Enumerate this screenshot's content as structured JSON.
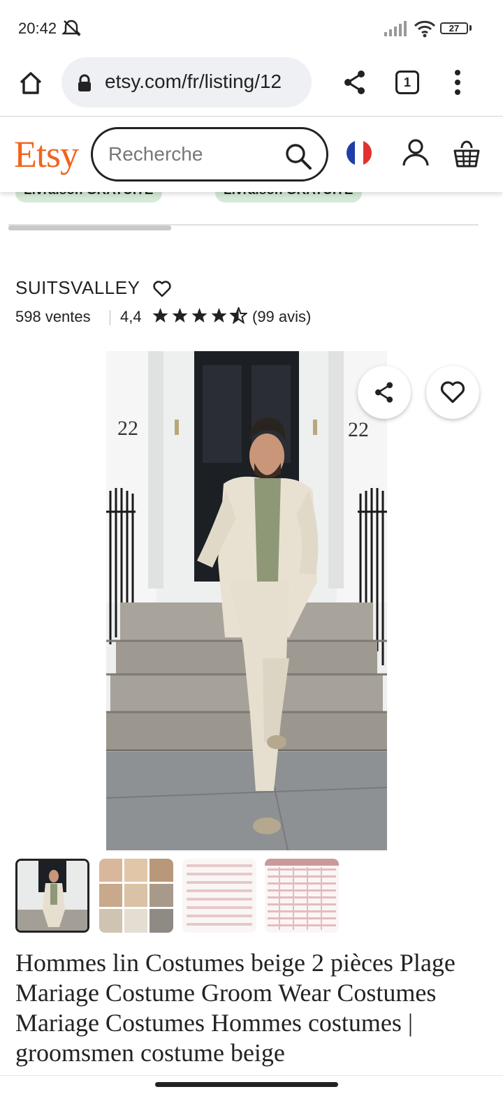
{
  "status_bar": {
    "time": "20:42",
    "battery": "27"
  },
  "browser": {
    "url": "etsy.com/fr/listing/12",
    "tab_count": "1"
  },
  "header": {
    "logo": "Etsy",
    "search_placeholder": "Recherche",
    "icons": [
      "search-icon",
      "french-flag-icon",
      "account-icon",
      "cart-icon"
    ]
  },
  "shipping_badges": [
    "Livraison GRATUITE",
    "Livraison GRATUITE"
  ],
  "shop": {
    "name": "SUITSVALLEY",
    "sales": "598 ventes",
    "rating": "4,4",
    "stars": 4.5,
    "reviews": "(99 avis)"
  },
  "image": {
    "house_number": "22"
  },
  "product": {
    "title": "Hommes lin Costumes beige 2 pièces Plage Mariage Costume Groom Wear Costumes Mariage Costumes Hommes costumes | groomsmen costume beige"
  },
  "colors": {
    "brand": "#f1641e",
    "badge": "#d4e9d7"
  }
}
